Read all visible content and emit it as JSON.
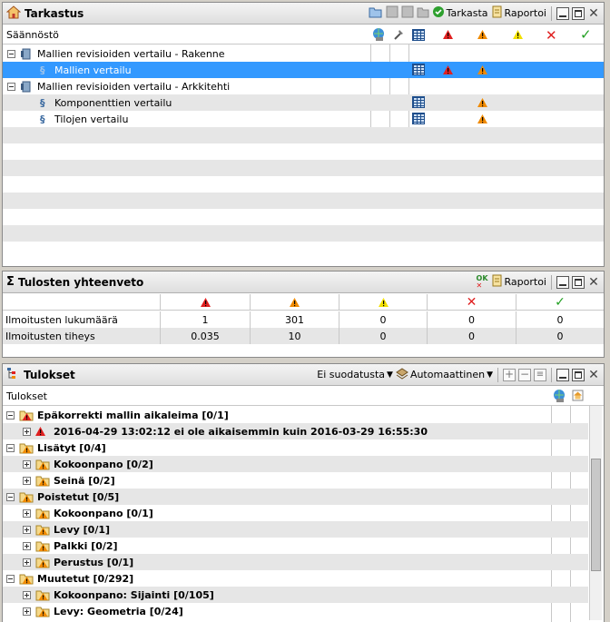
{
  "tarkastus": {
    "title": "Tarkastus",
    "check_label": "Tarkasta",
    "reports_label": "Raportoi",
    "column_header": "Säännöstö",
    "rows": [
      {
        "label": "Mallien revisioiden vertailu - Rakenne",
        "level": 0
      },
      {
        "label": "Mallien vertailu",
        "level": 1,
        "selected": true,
        "red": true,
        "orange": true
      },
      {
        "label": "Mallien revisioiden vertailu - Arkkitehti",
        "level": 0
      },
      {
        "label": "Komponenttien vertailu",
        "level": 1,
        "orange": true
      },
      {
        "label": "Tilojen vertailu",
        "level": 1,
        "orange": true
      }
    ]
  },
  "summary": {
    "title": "Tulosten yhteenveto",
    "reports_label": "Raportoi",
    "rows": [
      {
        "label": "Ilmoitusten lukumäärä",
        "values": [
          "1",
          "301",
          "0",
          "0",
          "0"
        ]
      },
      {
        "label": "Ilmoitusten tiheys",
        "values": [
          "0.035",
          "10",
          "0",
          "0",
          "0"
        ]
      }
    ]
  },
  "results": {
    "title": "Tulokset",
    "filter_label": "Ei suodatusta",
    "mode_label": "Automaattinen",
    "column_header": "Tulokset",
    "rows": [
      {
        "label": "Epäkorrekti mallin aikaleima [0/1]",
        "level": 0,
        "icon": "folder-red",
        "exp": "minus"
      },
      {
        "label": "2016-04-29 13:02:12 ei ole aikaisemmin kuin 2016-03-29 16:55:30",
        "level": 1,
        "icon": "red",
        "exp": "plus"
      },
      {
        "label": "Lisätyt [0/4]",
        "level": 0,
        "icon": "folder-orange",
        "exp": "minus"
      },
      {
        "label": "Kokoonpano [0/2]",
        "level": 1,
        "icon": "folder-orange",
        "exp": "plus"
      },
      {
        "label": "Seinä [0/2]",
        "level": 1,
        "icon": "folder-orange",
        "exp": "plus"
      },
      {
        "label": "Poistetut [0/5]",
        "level": 0,
        "icon": "folder-orange",
        "exp": "minus"
      },
      {
        "label": "Kokoonpano [0/1]",
        "level": 1,
        "icon": "folder-orange",
        "exp": "plus"
      },
      {
        "label": "Levy [0/1]",
        "level": 1,
        "icon": "folder-orange",
        "exp": "plus"
      },
      {
        "label": "Palkki [0/2]",
        "level": 1,
        "icon": "folder-orange",
        "exp": "plus"
      },
      {
        "label": "Perustus [0/1]",
        "level": 1,
        "icon": "folder-orange",
        "exp": "plus"
      },
      {
        "label": "Muutetut [0/292]",
        "level": 0,
        "icon": "folder-orange",
        "exp": "minus"
      },
      {
        "label": "Kokoonpano: Sijainti [0/105]",
        "level": 1,
        "icon": "folder-orange",
        "exp": "plus"
      },
      {
        "label": "Levy: Geometria [0/24]",
        "level": 1,
        "icon": "folder-orange",
        "exp": "plus"
      }
    ]
  },
  "colors": {
    "red": "#e02020",
    "orange": "#f08a00",
    "yellow": "#f2e000",
    "green": "#22a022",
    "selection": "#3399ff"
  }
}
